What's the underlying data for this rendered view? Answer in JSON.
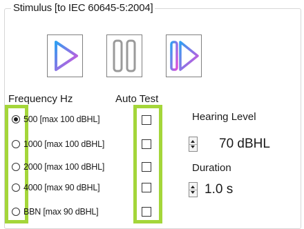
{
  "group": {
    "title": "Stimulus [to IEC 60645-5:2004]"
  },
  "transport": {
    "play_icon": "play-icon",
    "pause_icon": "pause-icon",
    "skip_icon": "play-next-icon",
    "gradient_start": "#2e9ff2",
    "gradient_end": "#e14dd9"
  },
  "headers": {
    "frequency": "Frequency Hz",
    "auto_test": "Auto Test"
  },
  "frequencies": [
    {
      "label": "500  [max 100 dBHL]",
      "selected": true,
      "auto_test": false
    },
    {
      "label": "1000 [max 100 dBHL]",
      "selected": false,
      "auto_test": false
    },
    {
      "label": "2000 [max 100 dBHL]",
      "selected": false,
      "auto_test": false
    },
    {
      "label": "4000 [max 90 dBHL]",
      "selected": false,
      "auto_test": false
    },
    {
      "label": "BBN [max 90 dBHL]",
      "selected": false,
      "auto_test": false
    }
  ],
  "hearing_level": {
    "label": "Hearing Level",
    "value": "70 dBHL"
  },
  "duration": {
    "label": "Duration",
    "value": "1.0 s"
  },
  "highlight_color": "#a4d63a"
}
